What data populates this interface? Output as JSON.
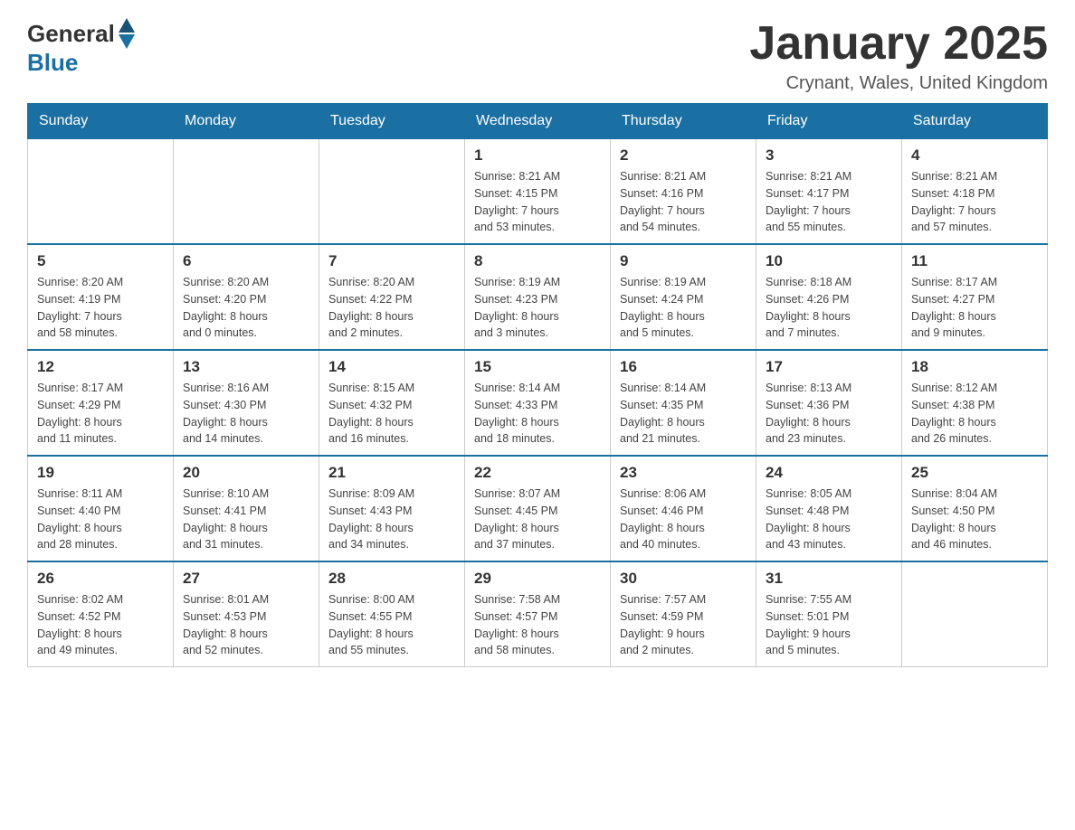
{
  "header": {
    "logo_general": "General",
    "logo_blue": "Blue",
    "month_title": "January 2025",
    "location": "Crynant, Wales, United Kingdom"
  },
  "days_of_week": [
    "Sunday",
    "Monday",
    "Tuesday",
    "Wednesday",
    "Thursday",
    "Friday",
    "Saturday"
  ],
  "weeks": [
    [
      {
        "day": "",
        "info": ""
      },
      {
        "day": "",
        "info": ""
      },
      {
        "day": "",
        "info": ""
      },
      {
        "day": "1",
        "info": "Sunrise: 8:21 AM\nSunset: 4:15 PM\nDaylight: 7 hours\nand 53 minutes."
      },
      {
        "day": "2",
        "info": "Sunrise: 8:21 AM\nSunset: 4:16 PM\nDaylight: 7 hours\nand 54 minutes."
      },
      {
        "day": "3",
        "info": "Sunrise: 8:21 AM\nSunset: 4:17 PM\nDaylight: 7 hours\nand 55 minutes."
      },
      {
        "day": "4",
        "info": "Sunrise: 8:21 AM\nSunset: 4:18 PM\nDaylight: 7 hours\nand 57 minutes."
      }
    ],
    [
      {
        "day": "5",
        "info": "Sunrise: 8:20 AM\nSunset: 4:19 PM\nDaylight: 7 hours\nand 58 minutes."
      },
      {
        "day": "6",
        "info": "Sunrise: 8:20 AM\nSunset: 4:20 PM\nDaylight: 8 hours\nand 0 minutes."
      },
      {
        "day": "7",
        "info": "Sunrise: 8:20 AM\nSunset: 4:22 PM\nDaylight: 8 hours\nand 2 minutes."
      },
      {
        "day": "8",
        "info": "Sunrise: 8:19 AM\nSunset: 4:23 PM\nDaylight: 8 hours\nand 3 minutes."
      },
      {
        "day": "9",
        "info": "Sunrise: 8:19 AM\nSunset: 4:24 PM\nDaylight: 8 hours\nand 5 minutes."
      },
      {
        "day": "10",
        "info": "Sunrise: 8:18 AM\nSunset: 4:26 PM\nDaylight: 8 hours\nand 7 minutes."
      },
      {
        "day": "11",
        "info": "Sunrise: 8:17 AM\nSunset: 4:27 PM\nDaylight: 8 hours\nand 9 minutes."
      }
    ],
    [
      {
        "day": "12",
        "info": "Sunrise: 8:17 AM\nSunset: 4:29 PM\nDaylight: 8 hours\nand 11 minutes."
      },
      {
        "day": "13",
        "info": "Sunrise: 8:16 AM\nSunset: 4:30 PM\nDaylight: 8 hours\nand 14 minutes."
      },
      {
        "day": "14",
        "info": "Sunrise: 8:15 AM\nSunset: 4:32 PM\nDaylight: 8 hours\nand 16 minutes."
      },
      {
        "day": "15",
        "info": "Sunrise: 8:14 AM\nSunset: 4:33 PM\nDaylight: 8 hours\nand 18 minutes."
      },
      {
        "day": "16",
        "info": "Sunrise: 8:14 AM\nSunset: 4:35 PM\nDaylight: 8 hours\nand 21 minutes."
      },
      {
        "day": "17",
        "info": "Sunrise: 8:13 AM\nSunset: 4:36 PM\nDaylight: 8 hours\nand 23 minutes."
      },
      {
        "day": "18",
        "info": "Sunrise: 8:12 AM\nSunset: 4:38 PM\nDaylight: 8 hours\nand 26 minutes."
      }
    ],
    [
      {
        "day": "19",
        "info": "Sunrise: 8:11 AM\nSunset: 4:40 PM\nDaylight: 8 hours\nand 28 minutes."
      },
      {
        "day": "20",
        "info": "Sunrise: 8:10 AM\nSunset: 4:41 PM\nDaylight: 8 hours\nand 31 minutes."
      },
      {
        "day": "21",
        "info": "Sunrise: 8:09 AM\nSunset: 4:43 PM\nDaylight: 8 hours\nand 34 minutes."
      },
      {
        "day": "22",
        "info": "Sunrise: 8:07 AM\nSunset: 4:45 PM\nDaylight: 8 hours\nand 37 minutes."
      },
      {
        "day": "23",
        "info": "Sunrise: 8:06 AM\nSunset: 4:46 PM\nDaylight: 8 hours\nand 40 minutes."
      },
      {
        "day": "24",
        "info": "Sunrise: 8:05 AM\nSunset: 4:48 PM\nDaylight: 8 hours\nand 43 minutes."
      },
      {
        "day": "25",
        "info": "Sunrise: 8:04 AM\nSunset: 4:50 PM\nDaylight: 8 hours\nand 46 minutes."
      }
    ],
    [
      {
        "day": "26",
        "info": "Sunrise: 8:02 AM\nSunset: 4:52 PM\nDaylight: 8 hours\nand 49 minutes."
      },
      {
        "day": "27",
        "info": "Sunrise: 8:01 AM\nSunset: 4:53 PM\nDaylight: 8 hours\nand 52 minutes."
      },
      {
        "day": "28",
        "info": "Sunrise: 8:00 AM\nSunset: 4:55 PM\nDaylight: 8 hours\nand 55 minutes."
      },
      {
        "day": "29",
        "info": "Sunrise: 7:58 AM\nSunset: 4:57 PM\nDaylight: 8 hours\nand 58 minutes."
      },
      {
        "day": "30",
        "info": "Sunrise: 7:57 AM\nSunset: 4:59 PM\nDaylight: 9 hours\nand 2 minutes."
      },
      {
        "day": "31",
        "info": "Sunrise: 7:55 AM\nSunset: 5:01 PM\nDaylight: 9 hours\nand 5 minutes."
      },
      {
        "day": "",
        "info": ""
      }
    ]
  ]
}
